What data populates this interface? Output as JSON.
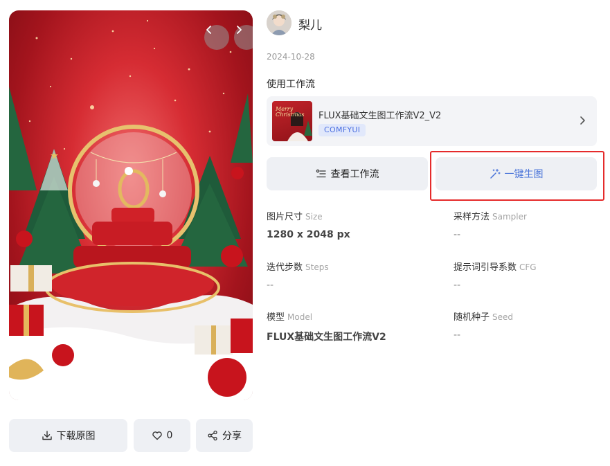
{
  "hero": {
    "prev_icon": "chevron-left-icon",
    "next_icon": "chevron-right-icon"
  },
  "author": {
    "name": "梨儿",
    "date": "2024-10-28"
  },
  "workflow_section": {
    "title": "使用工作流",
    "card": {
      "thumb_text_1": "Merry",
      "thumb_text_2": "Christmas",
      "name": "FLUX基础文生图工作流V2_V2",
      "tag": "COMFYUI",
      "chevron_icon": "chevron-right-icon"
    }
  },
  "buttons": {
    "view_workflow": "查看工作流",
    "one_click_generate": "一键生图"
  },
  "params": [
    {
      "label": "图片尺寸",
      "label_en": "Size",
      "value": "1280 x 2048 px"
    },
    {
      "label": "采样方法",
      "label_en": "Sampler",
      "value": "--"
    },
    {
      "label": "迭代步数",
      "label_en": "Steps",
      "value": "--"
    },
    {
      "label": "提示词引导系数",
      "label_en": "CFG",
      "value": "--"
    },
    {
      "label": "模型",
      "label_en": "Model",
      "value": "FLUX基础文生图工作流V2"
    },
    {
      "label": "随机种子",
      "label_en": "Seed",
      "value": "--"
    }
  ],
  "actions": {
    "download": "下载原图",
    "like_count": "0",
    "share": "分享"
  },
  "colors": {
    "accent_blue": "#4a74d9",
    "tag_bg": "#e1e8fb",
    "highlight_red": "#e52b2b",
    "button_bg": "#eef0f4"
  }
}
